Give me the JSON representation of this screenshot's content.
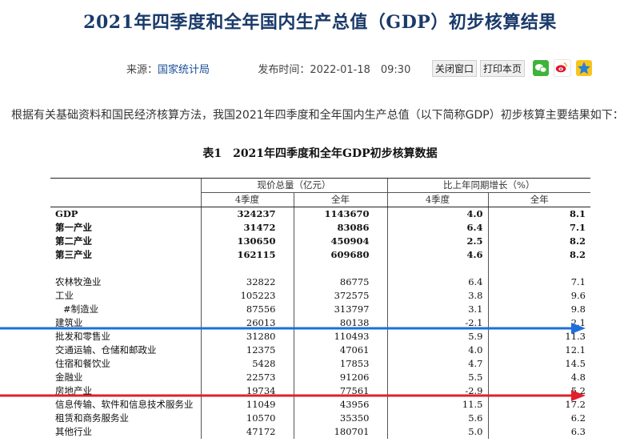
{
  "header": {
    "title": "2021年四季度和全年国内生产总值（GDP）初步核算结果",
    "source_label": "来源：",
    "source": "国家统计局",
    "publish_label": "发布时间：",
    "publish_time": "2022-01-18　09:30",
    "close_button": "关闭窗口",
    "print_button": "打印本页"
  },
  "intro": "根据有关基础资料和国民经济核算方法，我国2021年四季度和全年国内生产总值（以下简称GDP）初步核算主要结果如下：",
  "table": {
    "caption_id": "表1",
    "caption": "2021年四季度和全年GDP初步核算数据",
    "group_headers": [
      "现价总量（亿元）",
      "比上年同期增长（%）"
    ],
    "sub_headers": [
      "4季度",
      "全年",
      "4季度",
      "全年"
    ],
    "rows": [
      {
        "label": "GDP",
        "values": [
          "324237",
          "1143670",
          "4.0",
          "8.1"
        ]
      },
      {
        "label": "第一产业",
        "values": [
          "31472",
          "83086",
          "6.4",
          "7.1"
        ]
      },
      {
        "label": "第二产业",
        "values": [
          "130650",
          "450904",
          "2.5",
          "8.2"
        ]
      },
      {
        "label": "第三产业",
        "values": [
          "162115",
          "609680",
          "4.6",
          "8.2"
        ]
      },
      {
        "label": "农林牧渔业",
        "values": [
          "32822",
          "86775",
          "6.4",
          "7.1"
        ]
      },
      {
        "label": "工业",
        "values": [
          "105223",
          "372575",
          "3.8",
          "9.6"
        ]
      },
      {
        "label": "#制造业",
        "values": [
          "87556",
          "313797",
          "3.1",
          "9.8"
        ]
      },
      {
        "label": "建筑业",
        "values": [
          "26013",
          "80138",
          "-2.1",
          "2.1"
        ]
      },
      {
        "label": "批发和零售业",
        "values": [
          "31280",
          "110493",
          "5.9",
          "11.3"
        ]
      },
      {
        "label": "交通运输、仓储和邮政业",
        "values": [
          "12375",
          "47061",
          "4.0",
          "12.1"
        ]
      },
      {
        "label": "住宿和餐饮业",
        "values": [
          "5428",
          "17853",
          "4.7",
          "14.5"
        ]
      },
      {
        "label": "金融业",
        "values": [
          "22573",
          "91206",
          "5.5",
          "4.8"
        ]
      },
      {
        "label": "房地产业",
        "values": [
          "19734",
          "77561",
          "-2.9",
          "5.2"
        ]
      },
      {
        "label": "信息传输、软件和信息技术服务业",
        "values": [
          "11049",
          "43956",
          "11.5",
          "17.2"
        ]
      },
      {
        "label": "租赁和商务服务业",
        "values": [
          "10570",
          "35350",
          "5.6",
          "6.2"
        ]
      },
      {
        "label": "其他行业",
        "values": [
          "47172",
          "180701",
          "5.0",
          "6.3"
        ]
      }
    ]
  },
  "annotations": {
    "blue_arrow_color": "#1e6fd9",
    "red_arrow_color": "#e0202a"
  },
  "share_icons": [
    "wechat-icon",
    "weibo-icon",
    "qzone-icon"
  ]
}
